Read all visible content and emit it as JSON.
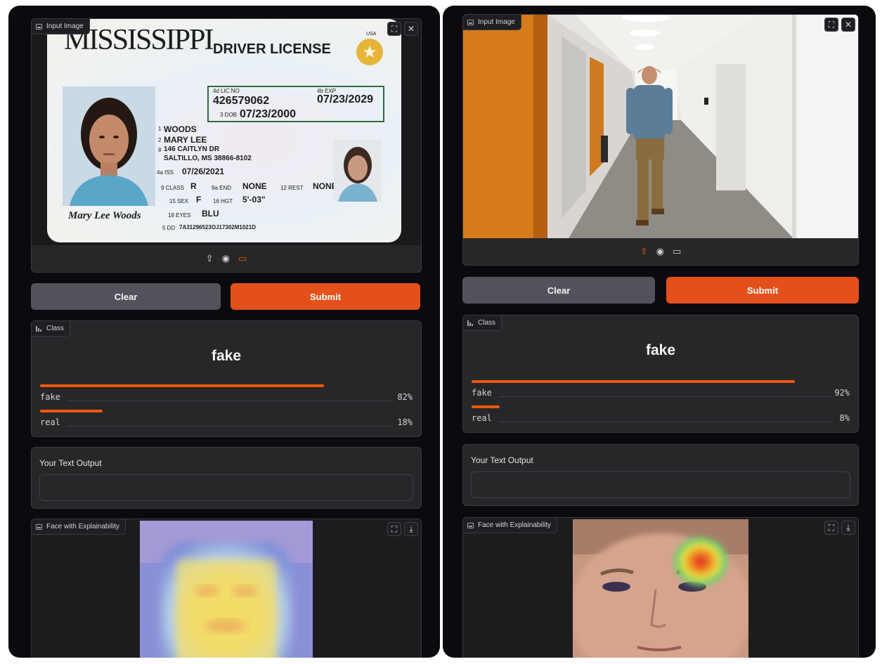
{
  "left": {
    "input_label": "Input Image",
    "id_card": {
      "state": "MISSISSIPPI",
      "doc_type": "DRIVER LICENSE",
      "usa": "USA",
      "lic_no_label": "4d LIC NO",
      "lic_no": "426579062",
      "exp_label": "4b EXP",
      "exp": "07/23/2029",
      "dob_label": "3 DOB",
      "dob": "07/23/2000",
      "last_name_num": "1",
      "last_name": "WOODS",
      "first_name_num": "2",
      "first_name": "MARY LEE",
      "address_num": "8",
      "address_line1": "146 CAITLYN DR",
      "address_line2": "SALTILLO, MS 38866-8102",
      "iss_label": "4a ISS",
      "iss": "07/26/2021",
      "class_label": "9 CLASS",
      "class_val": "R",
      "end_label": "9a END",
      "end_val": "NONE",
      "rest_label": "12 REST",
      "rest_val": "NONE",
      "sex_label": "15 SEX",
      "sex_val": "F",
      "hgt_label": "16 HGT",
      "hgt_val": "5'-03\"",
      "eyes_label": "18 EYES",
      "eyes_val": "BLU",
      "dd_label": "5 DD",
      "dd_val": "7A31296523OJ17302M1021D",
      "signature": "Mary Lee Woods"
    },
    "clear_label": "Clear",
    "submit_label": "Submit",
    "class_label": "Class",
    "predicted": "fake",
    "confidences": [
      {
        "label": "fake",
        "value": "82%",
        "fraction": 0.82
      },
      {
        "label": "real",
        "value": "18%",
        "fraction": 0.18
      }
    ],
    "text_output_label": "Your Text Output",
    "face_label": "Face with Explainability"
  },
  "right": {
    "input_label": "Input Image",
    "clear_label": "Clear",
    "submit_label": "Submit",
    "class_label": "Class",
    "predicted": "fake",
    "confidences": [
      {
        "label": "fake",
        "value": "92%",
        "fraction": 0.92
      },
      {
        "label": "real",
        "value": "8%",
        "fraction": 0.08
      }
    ],
    "text_output_label": "Your Text Output",
    "face_label": "Face with Explainability"
  },
  "icons": {
    "expand": "fullscreen-icon",
    "close": "close-icon",
    "upload": "upload-icon",
    "webcam": "webcam-icon",
    "clipboard": "clipboard-icon",
    "download": "download-icon",
    "image": "image-icon",
    "class": "bar-chart-icon"
  },
  "colors": {
    "accent": "#e4501c",
    "panel_bg": "#0b0b0f",
    "block_bg": "#27272a"
  }
}
